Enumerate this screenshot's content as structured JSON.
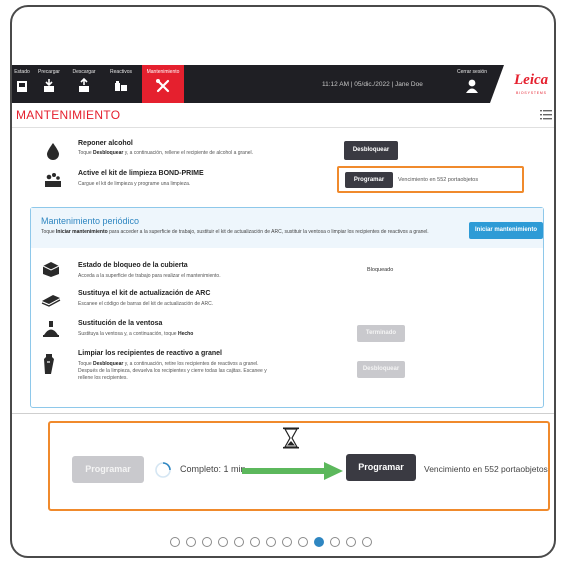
{
  "nav": {
    "items": [
      {
        "label": "Estado",
        "icon": "status-icon"
      },
      {
        "label": "Precargar",
        "icon": "preload-icon"
      },
      {
        "label": "Descargar",
        "icon": "unload-icon"
      },
      {
        "label": "Reactivos",
        "icon": "reagents-icon"
      },
      {
        "label": "Mantenimiento",
        "icon": "maintenance-icon",
        "active": true
      }
    ],
    "status_text": "11:12 AM  |  05/dic./2022  |  Jane Doe",
    "logout_label": "Cerrar sesión",
    "brand": "Leica",
    "brand_sub": "BIOSYSTEMS"
  },
  "page": {
    "title": "MANTENIMIENTO"
  },
  "rows": {
    "alcohol": {
      "title": "Reponer alcohol",
      "desc_pre": "Toque ",
      "desc_bold": "Desbloquear",
      "desc_post": " y, a continuación, rellene el recipiente de alcohol a granel.",
      "button": "Desbloquear"
    },
    "cleaning": {
      "title": "Active el kit de limpieza BOND-PRIME",
      "desc": "Cargue el kit de limpieza y programe una limpieza.",
      "button": "Programar",
      "due": "Vencimiento en 552 portaobjetos"
    }
  },
  "maintenance": {
    "title": "Mantenimiento periódico",
    "desc_pre": "Toque ",
    "desc_bold": "Iniciar mantenimiento",
    "desc_post": " para acceder a la superficie de trabajo, sustituir el kit de actualización de ARC, sustituir la ventosa o limpiar los recipientes de reactivos a granel.",
    "start_button": "Iniciar mantenimiento",
    "items": [
      {
        "title": "Estado de bloqueo de la cubierta",
        "desc": "Acceda a la superficie de trabajo para realizar el mantenimiento.",
        "status": "Bloqueado"
      },
      {
        "title": "Sustituya el kit de actualización de ARC",
        "desc": "Escanee el código de barras del kit de actualización de ARC."
      },
      {
        "title": "Sustitución de la ventosa",
        "desc_pre": "Sustituya la ventosa y, a continuación, toque ",
        "desc_bold": "Hecho",
        "button": "Terminado"
      },
      {
        "title": "Limpiar los recipientes de reactivo a granel",
        "desc_pre": "Toque ",
        "desc_bold": "Desbloquear",
        "desc_line1_post": " y, a continuación, retire los recipientes de reactivos a granel.",
        "desc_line2": "Después de la limpieza, devuelva los recipientes y cierre todas las cajitas. Escanee y",
        "desc_line3": "rellene los recipientes.",
        "button": "Desbloquear"
      }
    ]
  },
  "callout": {
    "disabled_button": "Programar",
    "complete_text": "Completo: 1 min",
    "button": "Programar",
    "due": "Vencimiento en 552 portaobjetos"
  },
  "pager": {
    "total": 13,
    "current": 10
  },
  "colors": {
    "accent_red": "#e5202e",
    "accent_blue": "#2e9bd6",
    "highlight_orange": "#f08a2c",
    "arrow_green": "#5cb85c"
  }
}
